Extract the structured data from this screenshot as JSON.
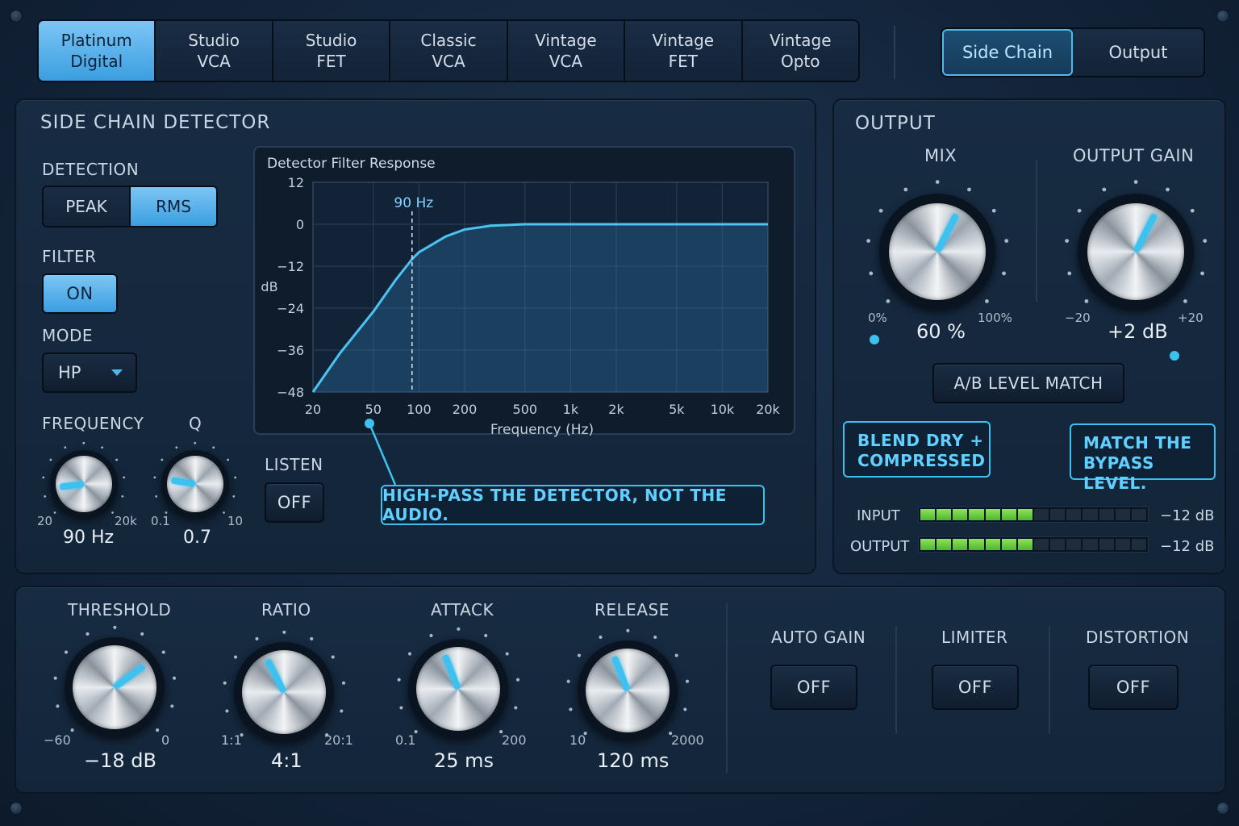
{
  "presets": {
    "items": [
      {
        "line1": "Platinum",
        "line2": "Digital",
        "active": true
      },
      {
        "line1": "Studio",
        "line2": "VCA",
        "active": false
      },
      {
        "line1": "Studio",
        "line2": "FET",
        "active": false
      },
      {
        "line1": "Classic",
        "line2": "VCA",
        "active": false
      },
      {
        "line1": "Vintage",
        "line2": "VCA",
        "active": false
      },
      {
        "line1": "Vintage",
        "line2": "FET",
        "active": false
      },
      {
        "line1": "Vintage",
        "line2": "Opto",
        "active": false
      }
    ]
  },
  "view_tabs": {
    "side_chain": "Side Chain",
    "output": "Output",
    "active": "side_chain"
  },
  "side_chain": {
    "title": "SIDE CHAIN DETECTOR",
    "detection_label": "DETECTION",
    "detection_peak": "PEAK",
    "detection_rms": "RMS",
    "detection_selected": "RMS",
    "filter_label": "FILTER",
    "filter_button": "ON",
    "mode_label": "MODE",
    "mode_value": "HP",
    "frequency": {
      "label": "FREQUENCY",
      "min": "20",
      "max": "20k",
      "value": "90 Hz",
      "level": 0.14
    },
    "q": {
      "label": "Q",
      "min": "0.1",
      "max": "10",
      "value": "0.7",
      "level": 0.2
    },
    "listen_label": "LISTEN",
    "listen_button": "OFF"
  },
  "graph": {
    "title": "Detector Filter Response",
    "ylabel": "dB",
    "xlabel": "Frequency (Hz)",
    "marker_label": "90 Hz",
    "y_ticks": [
      "12",
      "0",
      "−12",
      "−24",
      "−36",
      "−48"
    ],
    "x_ticks": [
      "20",
      "50",
      "100",
      "200",
      "500",
      "1k",
      "2k",
      "5k",
      "10k",
      "20k"
    ]
  },
  "chart_data": {
    "type": "line",
    "title": "Detector Filter Response",
    "xlabel": "Frequency (Hz)",
    "ylabel": "dB",
    "xscale": "log",
    "xlim": [
      20,
      20000
    ],
    "ylim": [
      -48,
      12
    ],
    "grid": true,
    "marker_x": 90,
    "x": [
      20,
      30,
      50,
      70,
      90,
      100,
      150,
      200,
      300,
      500,
      1000,
      2000,
      5000,
      10000,
      20000
    ],
    "y": [
      -48,
      -37,
      -25,
      -16,
      -10,
      -8,
      -3.5,
      -1.5,
      -0.4,
      0,
      0,
      0,
      0,
      0,
      0
    ]
  },
  "output": {
    "title": "OUTPUT",
    "mix": {
      "label": "MIX",
      "min": "0%",
      "max": "100%",
      "value": "60 %",
      "level": 0.6
    },
    "gain": {
      "label": "OUTPUT GAIN",
      "min": "−20",
      "max": "+20",
      "value": "+2 dB",
      "level": 0.6
    },
    "ab_button": "A/B LEVEL MATCH",
    "input_label": "INPUT",
    "output_label": "OUTPUT",
    "input_value": "−12 dB",
    "output_value": "−12 dB",
    "input_level": 0.48,
    "output_level": 0.48
  },
  "callouts": {
    "detector": "HIGH-PASS THE DETECTOR, NOT THE AUDIO.",
    "blend_1": "BLEND DRY +",
    "blend_2": "COMPRESSED",
    "match_1": "MATCH THE",
    "match_2": "BYPASS LEVEL."
  },
  "dynamics": {
    "threshold": {
      "label": "THRESHOLD",
      "min": "−60",
      "max": "0",
      "value": "−18 dB",
      "level": 0.7
    },
    "ratio": {
      "label": "RATIO",
      "min": "1:1",
      "max": "20:1",
      "value": "4:1",
      "level": 0.4
    },
    "attack": {
      "label": "ATTACK",
      "min": "0.1",
      "max": "200",
      "value": "25 ms",
      "level": 0.42
    },
    "release": {
      "label": "RELEASE",
      "min": "10",
      "max": "2000",
      "value": "120 ms",
      "level": 0.42
    },
    "auto_gain": {
      "label": "AUTO GAIN",
      "button": "OFF"
    },
    "limiter": {
      "label": "LIMITER",
      "button": "OFF"
    },
    "distortion": {
      "label": "DISTORTION",
      "button": "OFF"
    }
  },
  "colors": {
    "accent": "#3fc1f0",
    "active_button": "#5fb3ec",
    "meter_green": "#6fcf3f"
  }
}
